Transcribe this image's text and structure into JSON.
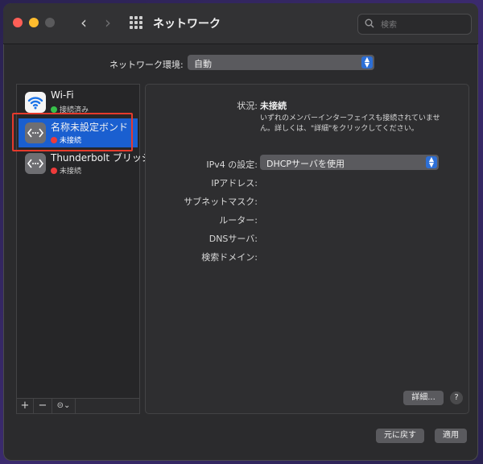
{
  "window": {
    "title": "ネットワーク"
  },
  "search": {
    "placeholder": "検索"
  },
  "network_environment": {
    "label": "ネットワーク環境:",
    "value": "自動"
  },
  "services": [
    {
      "name": "Wi-Fi",
      "status": "接続済み",
      "status_color": "#37c14a",
      "selected": false
    },
    {
      "name": "名称未設定ボンド",
      "status": "未接続",
      "status_color": "#ee3b3b",
      "selected": true
    },
    {
      "name": "Thunderbolt ブリッジ",
      "status": "未接続",
      "status_color": "#ee3b3b",
      "selected": false
    }
  ],
  "sidebar_controls": {
    "add": "+",
    "remove": "−",
    "actions": "⊝⌄"
  },
  "detail": {
    "status_label": "状況:",
    "status_value": "未接続",
    "status_description": "いずれのメンバーインターフェイスも接続されていません。詳しくは、\"詳細\"をクリックしてください。",
    "ipv4_label": "IPv4 の設定:",
    "ipv4_value": "DHCPサーバを使用",
    "ip_address_label": "IPアドレス:",
    "subnet_mask_label": "サブネットマスク:",
    "router_label": "ルーター:",
    "dns_label": "DNSサーバ:",
    "search_domain_label": "検索ドメイン:",
    "advanced_button": "詳細...",
    "help_button": "?"
  },
  "footer": {
    "revert_button": "元に戻す",
    "apply_button": "適用"
  },
  "colors": {
    "accent": "#1a5fd0",
    "highlight_border": "#e53a2c"
  }
}
